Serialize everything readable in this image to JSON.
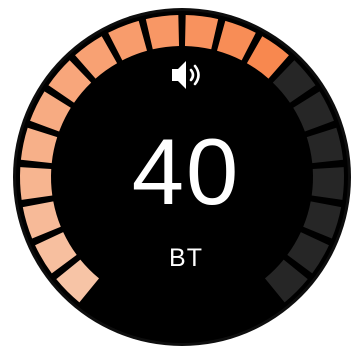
{
  "volume_display": {
    "value": "40",
    "unit": "BT",
    "icon": "speaker-volume-icon",
    "segments_total": 20,
    "segments_active": 13,
    "colors": {
      "background": "#000000",
      "bezel": "#0e0e0e",
      "inactive_segment": "#262626",
      "active_start": "#f7c4a6",
      "active_end": "#f8884f",
      "text": "#ffffff"
    }
  }
}
